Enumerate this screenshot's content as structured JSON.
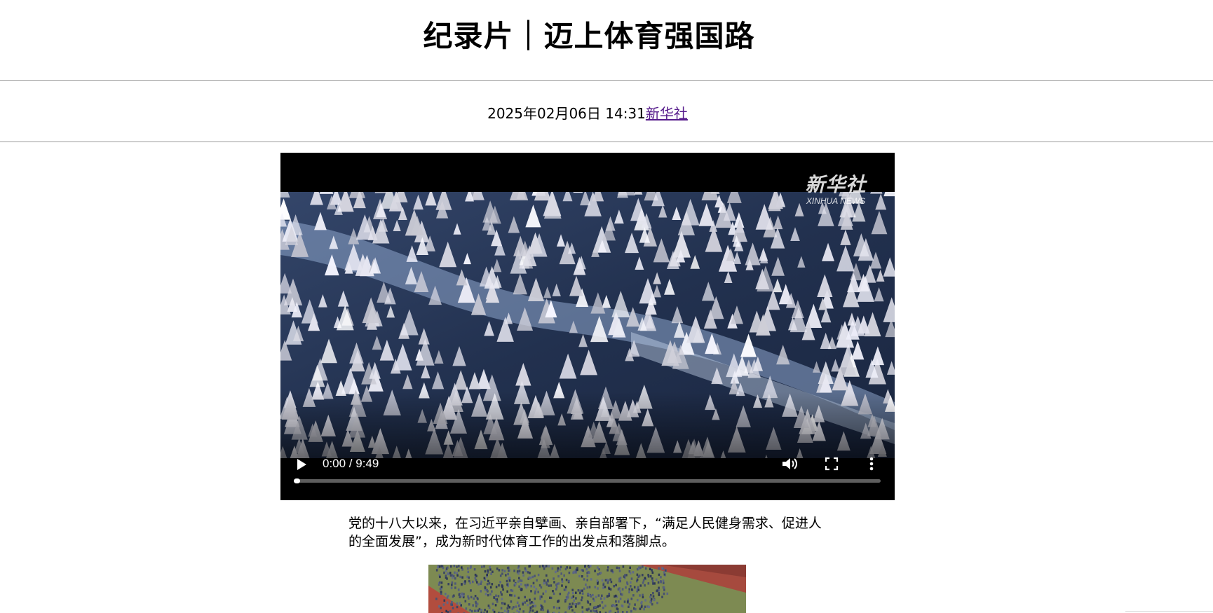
{
  "article": {
    "title": "纪录片｜迈上体育强国路",
    "date": "2025年02月06日 14:31",
    "source": "新华社",
    "paragraph": "党的十八大以来，在习近平亲自擘画、亲自部署下，“满足人民健身需求、促进人的全面发展”，成为新时代体育工作的出发点和落脚点。"
  },
  "video": {
    "time_display": "0:00 / 9:49",
    "progress_fraction": 0.0,
    "watermark_cn": "新华社",
    "watermark_en": "XINHUA NEWS",
    "icons": [
      "play-icon",
      "volume-icon",
      "fullscreen-icon",
      "more-vertical-icon"
    ]
  },
  "colors": {
    "link": "#551a8b",
    "video_background": "#000000",
    "rule": "#9a9a9a"
  }
}
